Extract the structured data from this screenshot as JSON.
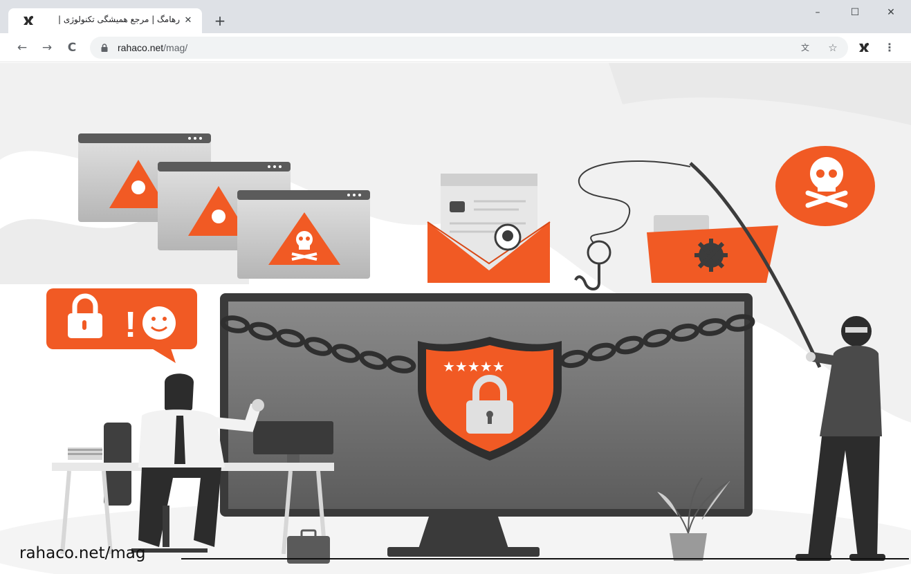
{
  "browser": {
    "tab": {
      "title": "رهامگ | مرجع همیشگی تکنولوژی |",
      "close_label": "✕",
      "favicon": "rahaco-favicon"
    },
    "new_tab_label": "+",
    "window_controls": {
      "minimize": "–",
      "maximize": "☐",
      "close": "✕"
    },
    "nav": {
      "back": "←",
      "forward": "→",
      "reload": "C"
    },
    "address": {
      "host": "rahaco.net",
      "path": "/mag/"
    },
    "omnibox_icons": [
      "translate-icon",
      "star-icon"
    ],
    "translate_glyph": "文",
    "star_glyph": "☆",
    "menu_glyph": "⋮"
  },
  "page": {
    "watermark": "rahaco.net/mag",
    "accent_color": "#f15a24",
    "dark_gray": "#4a4a4a",
    "speech_bubble_symbol": "!"
  }
}
